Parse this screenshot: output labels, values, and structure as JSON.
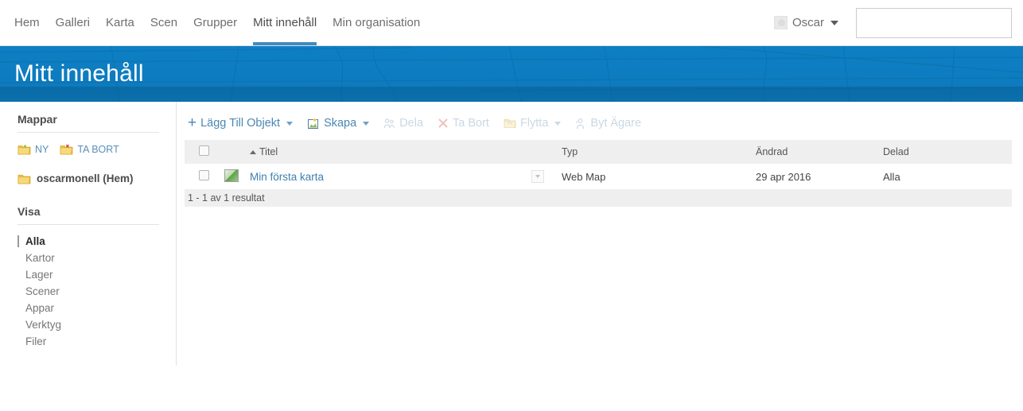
{
  "nav": {
    "items": [
      {
        "label": "Hem",
        "active": false
      },
      {
        "label": "Galleri",
        "active": false
      },
      {
        "label": "Karta",
        "active": false
      },
      {
        "label": "Scen",
        "active": false
      },
      {
        "label": "Grupper",
        "active": false
      },
      {
        "label": "Mitt innehåll",
        "active": true
      },
      {
        "label": "Min organisation",
        "active": false
      }
    ],
    "user": {
      "name": "Oscar",
      "avatar_icon": "user-avatar-icon",
      "caret_icon": "caret-down-icon"
    },
    "search": {
      "placeholder": "",
      "value": "",
      "icon": "search-icon"
    },
    "active_underline_color": "#3f8cc3"
  },
  "banner": {
    "title": "Mitt innehåll",
    "color": "#0d7bbe"
  },
  "sidebar": {
    "folders_heading": "Mappar",
    "folder_actions": [
      {
        "label": "NY",
        "icon": "folder-new-icon"
      },
      {
        "label": "TA BORT",
        "icon": "folder-delete-icon"
      }
    ],
    "home_folder": {
      "label": "oscarmonell (Hem)",
      "icon": "folder-icon"
    },
    "view_heading": "Visa",
    "filters": [
      {
        "label": "Alla",
        "active": true
      },
      {
        "label": "Kartor",
        "active": false
      },
      {
        "label": "Lager",
        "active": false
      },
      {
        "label": "Scener",
        "active": false
      },
      {
        "label": "Appar",
        "active": false
      },
      {
        "label": "Verktyg",
        "active": false
      },
      {
        "label": "Filer",
        "active": false
      }
    ]
  },
  "toolbar": {
    "add_item": {
      "label": "Lägg Till Objekt",
      "icon": "plus-icon",
      "enabled": true,
      "has_caret": true
    },
    "create": {
      "label": "Skapa",
      "icon": "create-map-icon",
      "enabled": true,
      "has_caret": true
    },
    "share": {
      "label": "Dela",
      "icon": "share-people-icon",
      "enabled": false,
      "has_caret": false
    },
    "delete": {
      "label": "Ta Bort",
      "icon": "delete-x-icon",
      "enabled": false,
      "has_caret": false
    },
    "move": {
      "label": "Flytta",
      "icon": "move-folder-icon",
      "enabled": false,
      "has_caret": true
    },
    "change_owner": {
      "label": "Byt Ägare",
      "icon": "change-owner-icon",
      "enabled": false,
      "has_caret": false
    }
  },
  "table": {
    "headers": {
      "title": "Titel",
      "type": "Typ",
      "modified": "Ändrad",
      "shared": "Delad"
    },
    "sorted_by": "title",
    "sort_direction": "asc",
    "rows": [
      {
        "title": "Min första karta",
        "type": "Web Map",
        "modified": "29 apr 2016",
        "shared": "Alla",
        "thumbnail_icon": "map-thumbnail-icon",
        "selected": false
      }
    ],
    "results_text": "1 - 1 av 1 resultat"
  }
}
